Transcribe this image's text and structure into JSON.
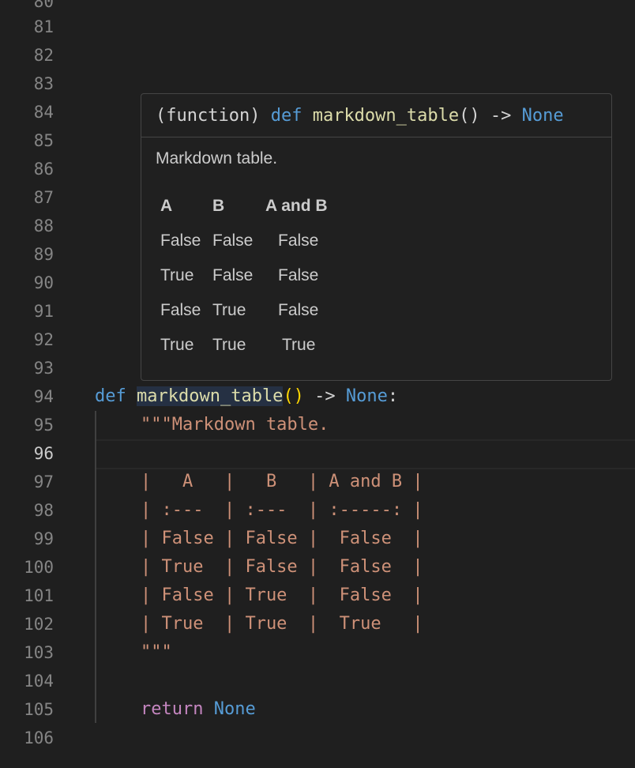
{
  "editor": {
    "line_numbers": [
      "80",
      "81",
      "82",
      "83",
      "84",
      "85",
      "86",
      "87",
      "88",
      "89",
      "90",
      "91",
      "92",
      "93",
      "94",
      "95",
      "96",
      "97",
      "98",
      "99",
      "100",
      "101",
      "102",
      "103",
      "104",
      "105",
      "106"
    ],
    "active_line": "96",
    "code": {
      "def_kw": "def",
      "func_name": "markdown_table",
      "parens": "()",
      "arrow": " -> ",
      "ret_type": "None",
      "colon": ":",
      "doc_open": "\"\"\"Markdown table.",
      "table_lines": [
        "|   A   |   B   | A and B |",
        "| :---  | :---  | :-----: |",
        "| False | False |  False  |",
        "| True  | False |  False  |",
        "| False | True  |  False  |",
        "| True  | True  |  True   |"
      ],
      "doc_close": "\"\"\"",
      "return_kw": "return",
      "return_val": "None"
    }
  },
  "hover": {
    "sig_prefix": "(function) ",
    "sig_def": "def",
    "sig_name": "markdown_table",
    "sig_parens": "()",
    "sig_arrow": " -> ",
    "sig_ret": "None",
    "doc_text": "Markdown table.",
    "table": {
      "headers": [
        "A",
        "B",
        "A and B"
      ],
      "rows": [
        [
          "False",
          "False",
          "False"
        ],
        [
          "True",
          "False",
          "False"
        ],
        [
          "False",
          "True",
          "False"
        ],
        [
          "True",
          "True",
          "True"
        ]
      ]
    }
  },
  "colors": {
    "background": "#1f1f1f",
    "keyword": "#569cd6",
    "control_keyword": "#c586c0",
    "function": "#dcdcaa",
    "string": "#ce9178",
    "bracket": "#ffd700",
    "line_number": "#858585"
  }
}
